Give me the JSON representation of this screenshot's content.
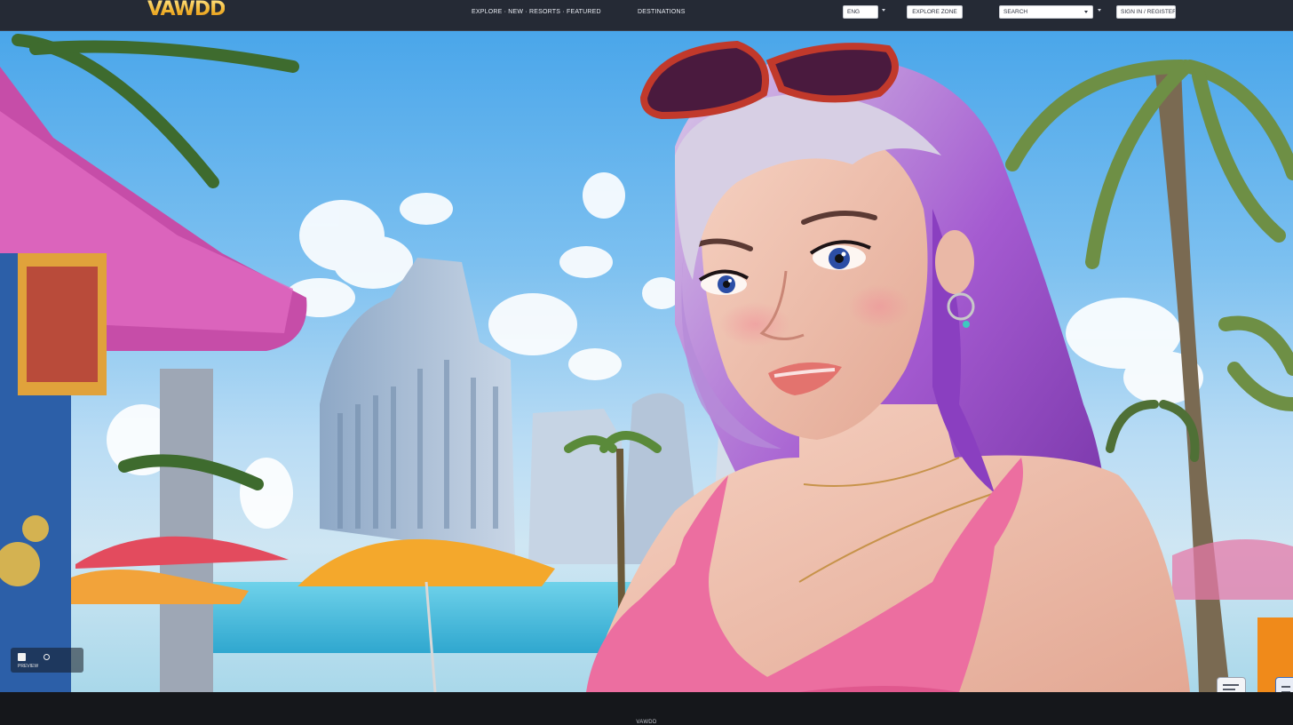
{
  "header": {
    "logo": "VAWDD",
    "nav": [
      "EXPLORE · NEW · RESORTS · FEATURED",
      "DESTINATIONS"
    ],
    "language_button": "ENG",
    "region_button": "EXPLORE ZONE",
    "search_select": "SEARCH",
    "signin_button": "SIGN IN / REGISTER"
  },
  "hero": {
    "image_icon_name": "beach-resort-portrait-illustration",
    "caption": "PREVIEW"
  },
  "footer": {
    "text": "VAWDD"
  },
  "colors": {
    "header_bg": "#252a35",
    "footer_bg": "#15171b",
    "logo_gold": "#f2b530",
    "accent_pink": "#e0408c"
  }
}
